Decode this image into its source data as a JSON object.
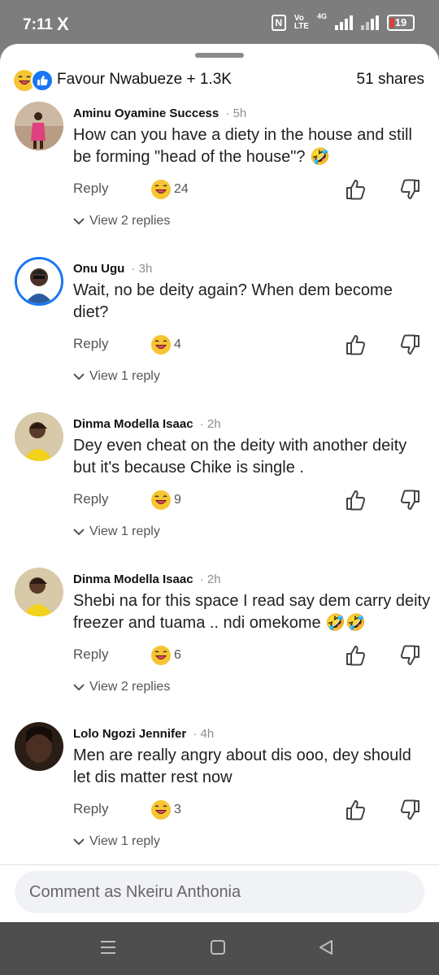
{
  "status_bar": {
    "time": "7:11",
    "app_icon": "X",
    "nfc": "N",
    "volte": "Vo\nLTE",
    "network": "4G",
    "battery": "19"
  },
  "header": {
    "reactions": "Favour Nwabueze + 1.3K",
    "shares": "51 shares"
  },
  "comments": [
    {
      "author": "Aminu Oyamine Success",
      "time": "5h",
      "text": "How can you have a diety in the house and still be forming \"head of the house\"? 🤣",
      "reply_label": "Reply",
      "reaction_count": "24",
      "view_replies": "View 2 replies"
    },
    {
      "author": "Onu Ugu",
      "time": "3h",
      "text": "Wait, no be deity again? When dem become diet?",
      "reply_label": "Reply",
      "reaction_count": "4",
      "view_replies": "View 1 reply"
    },
    {
      "author": "Dinma Modella Isaac",
      "time": "2h",
      "text": "Dey even cheat on the deity with another deity but it's because Chike is single .",
      "reply_label": "Reply",
      "reaction_count": "9",
      "view_replies": "View 1 reply"
    },
    {
      "author": "Dinma Modella Isaac",
      "time": "2h",
      "text": "Shebi na for this space I read say dem carry deity freezer and tuama .. ndi omekome 🤣🤣",
      "reply_label": "Reply",
      "reaction_count": "6",
      "view_replies": "View 2 replies"
    },
    {
      "author": "Lolo Ngozi Jennifer",
      "time": "4h",
      "text": "Men are really angry about dis ooo, dey should let dis matter rest now",
      "reply_label": "Reply",
      "reaction_count": "3",
      "view_replies": "View 1 reply"
    }
  ],
  "composer": {
    "placeholder": "Comment as Nkeiru Anthonia"
  },
  "colors": {
    "accent": "#1877f2",
    "emoji": "#f7c531",
    "nav_bar": "#4e4e4e"
  },
  "icons": [
    "laughing-emoji-icon",
    "like-reaction-icon",
    "thumbs-up-icon",
    "thumbs-down-icon",
    "chevron-down-icon",
    "menu-icon",
    "home-icon",
    "back-icon"
  ]
}
